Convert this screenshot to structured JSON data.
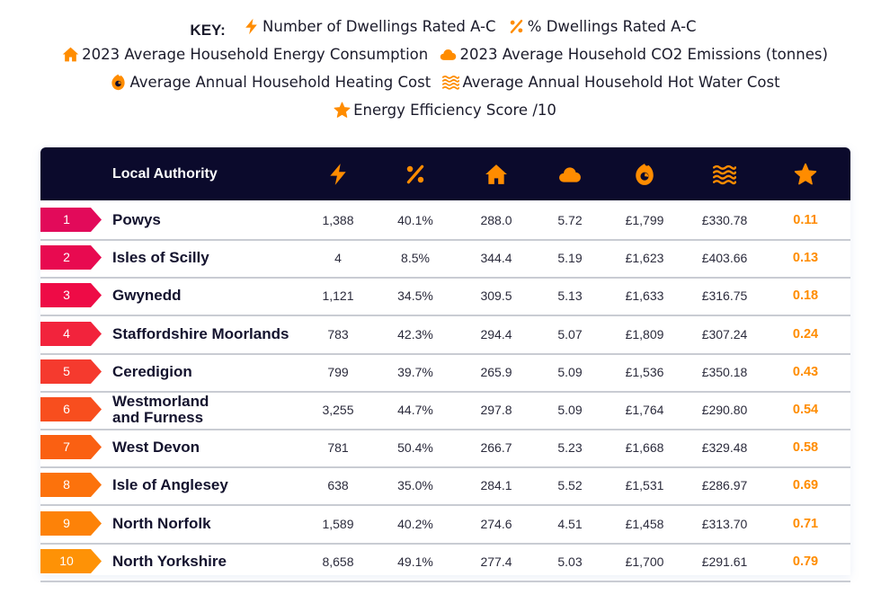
{
  "key": {
    "title": "KEY:",
    "items": [
      {
        "icon": "lightning-icon",
        "label": "Number of Dwellings Rated A-C"
      },
      {
        "icon": "percent-icon",
        "label": "% Dwellings Rated A-C"
      },
      {
        "icon": "house-icon",
        "label": "2023 Average Household Energy Consumption"
      },
      {
        "icon": "cloud-icon",
        "label": "2023 Average Household CO2 Emissions (tonnes)"
      },
      {
        "icon": "flame-icon",
        "label": "Average Annual Household Heating Cost"
      },
      {
        "icon": "waves-icon",
        "label": "Average Annual Household Hot Water Cost"
      },
      {
        "icon": "star-icon",
        "label": "Energy Efficiency Score /10"
      }
    ]
  },
  "colors": {
    "header_bg": "#0b0a2c",
    "accent": "#ff8c00",
    "rank_colors": [
      "#e20a5a",
      "#e80a50",
      "#ee0b46",
      "#f2233c",
      "#f53a2e",
      "#f84e1e",
      "#fa6012",
      "#fc720c",
      "#fd8208",
      "#fe9206"
    ]
  },
  "table": {
    "header": {
      "local_authority": "Local Authority",
      "icons": [
        "lightning-icon",
        "percent-icon",
        "house-icon",
        "cloud-icon",
        "flame-icon",
        "waves-icon",
        "star-icon"
      ]
    },
    "rows": [
      {
        "rank": "1",
        "name": "Powys",
        "dwellings": "1,388",
        "pct": "40.1%",
        "energy": "288.0",
        "co2": "5.72",
        "heating": "£1,799",
        "hot_water": "£330.78",
        "score": "0.11"
      },
      {
        "rank": "2",
        "name": "Isles of Scilly",
        "dwellings": "4",
        "pct": "8.5%",
        "energy": "344.4",
        "co2": "5.19",
        "heating": "£1,623",
        "hot_water": "£403.66",
        "score": "0.13"
      },
      {
        "rank": "3",
        "name": "Gwynedd",
        "dwellings": "1,121",
        "pct": "34.5%",
        "energy": "309.5",
        "co2": "5.13",
        "heating": "£1,633",
        "hot_water": "£316.75",
        "score": "0.18"
      },
      {
        "rank": "4",
        "name": "Staffordshire Moorlands",
        "dwellings": "783",
        "pct": "42.3%",
        "energy": "294.4",
        "co2": "5.07",
        "heating": "£1,809",
        "hot_water": "£307.24",
        "score": "0.24"
      },
      {
        "rank": "5",
        "name": "Ceredigion",
        "dwellings": "799",
        "pct": "39.7%",
        "energy": "265.9",
        "co2": "5.09",
        "heating": "£1,536",
        "hot_water": "£350.18",
        "score": "0.43"
      },
      {
        "rank": "6",
        "name": "Westmorland and Furness",
        "dwellings": "3,255",
        "pct": "44.7%",
        "energy": "297.8",
        "co2": "5.09",
        "heating": "£1,764",
        "hot_water": "£290.80",
        "score": "0.54"
      },
      {
        "rank": "7",
        "name": "West Devon",
        "dwellings": "781",
        "pct": "50.4%",
        "energy": "266.7",
        "co2": "5.23",
        "heating": "£1,668",
        "hot_water": "£329.48",
        "score": "0.58"
      },
      {
        "rank": "8",
        "name": "Isle of Anglesey",
        "dwellings": "638",
        "pct": "35.0%",
        "energy": "284.1",
        "co2": "5.52",
        "heating": "£1,531",
        "hot_water": "£286.97",
        "score": "0.69"
      },
      {
        "rank": "9",
        "name": "North Norfolk",
        "dwellings": "1,589",
        "pct": "40.2%",
        "energy": "274.6",
        "co2": "4.51",
        "heating": "£1,458",
        "hot_water": "£313.70",
        "score": "0.71"
      },
      {
        "rank": "10",
        "name": "North Yorkshire",
        "dwellings": "8,658",
        "pct": "49.1%",
        "energy": "277.4",
        "co2": "5.03",
        "heating": "£1,700",
        "hot_water": "£291.61",
        "score": "0.79"
      }
    ]
  }
}
